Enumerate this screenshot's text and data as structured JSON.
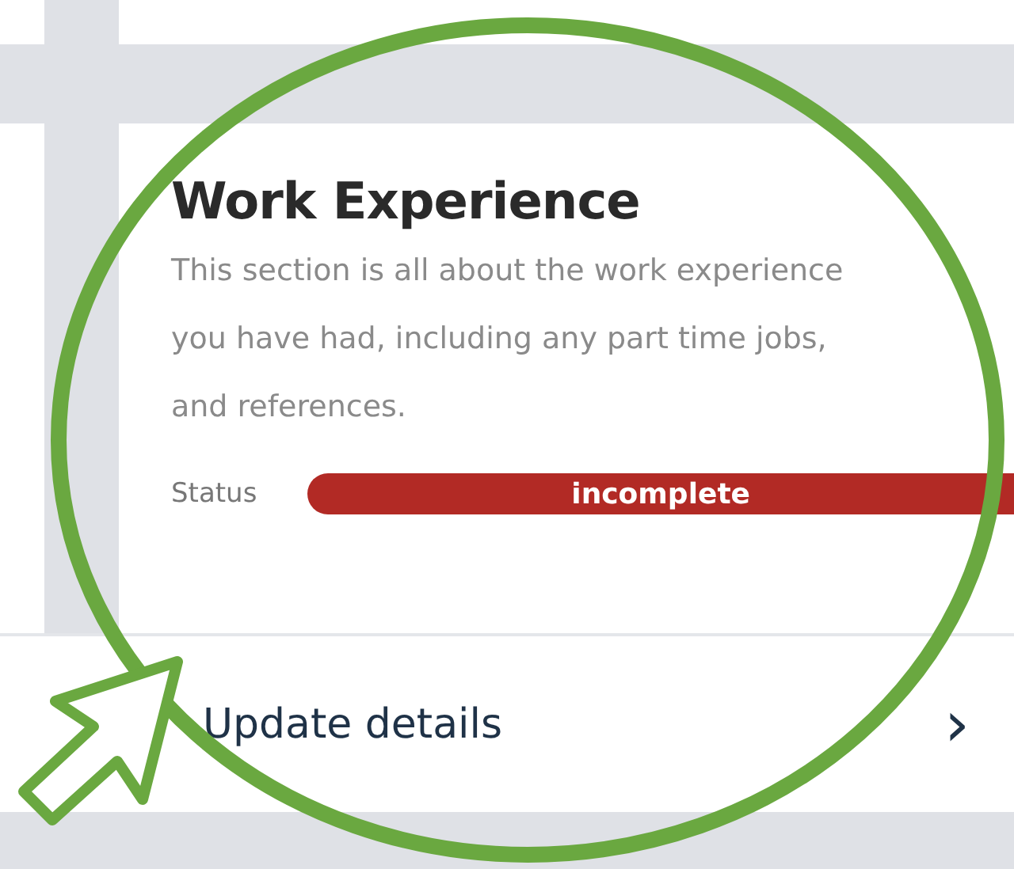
{
  "card": {
    "title": "Work Experience",
    "description": "This section is all about the work experience you have had, including any part time jobs, and references.",
    "status": {
      "label": "Status",
      "value": "incomplete",
      "kind": "incomplete"
    }
  },
  "action": {
    "label": "Update details",
    "chevron": "›"
  }
}
